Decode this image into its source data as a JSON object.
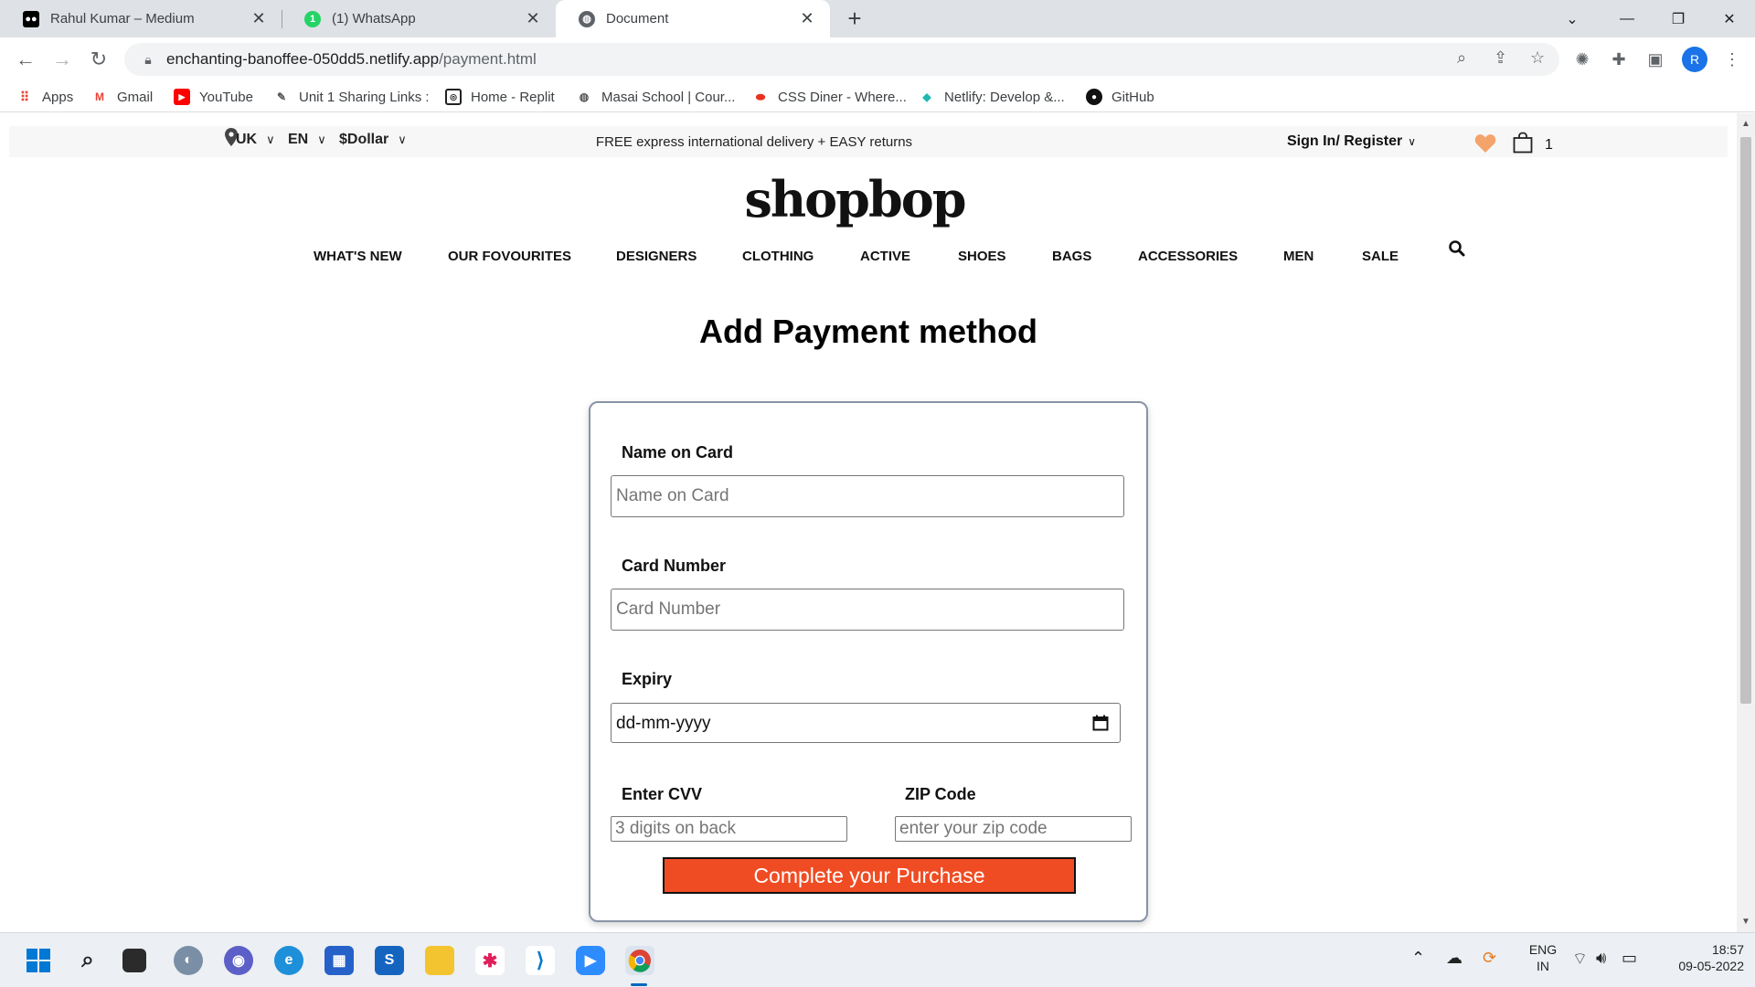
{
  "browser": {
    "tabs": [
      {
        "title": "Rahul Kumar – Medium",
        "icon": "medium-icon",
        "active": false
      },
      {
        "title": "(1) WhatsApp",
        "icon": "whatsapp-icon",
        "active": false
      },
      {
        "title": "Document",
        "icon": "globe-icon",
        "active": true
      }
    ],
    "url_domain": "enchanting-banoffee-050dd5.netlify.app",
    "url_path": "/payment.html",
    "profile_initial": "R",
    "bookmarks": [
      {
        "label": "Apps",
        "icon": "apps-grid-icon"
      },
      {
        "label": "Gmail",
        "icon": "gmail-icon"
      },
      {
        "label": "YouTube",
        "icon": "youtube-icon"
      },
      {
        "label": "Unit 1 Sharing Links :",
        "icon": "pen-icon"
      },
      {
        "label": "Home - Replit",
        "icon": "replit-icon"
      },
      {
        "label": "Masai School | Cour...",
        "icon": "masai-icon"
      },
      {
        "label": "CSS Diner - Where...",
        "icon": "css-diner-icon"
      },
      {
        "label": "Netlify: Develop &...",
        "icon": "netlify-icon"
      },
      {
        "label": "GitHub",
        "icon": "github-icon"
      }
    ]
  },
  "topbar": {
    "country": "UK",
    "language": "EN",
    "currency": "$Dollar",
    "delivery_text": "FREE express international delivery + EASY returns",
    "signin_label": "Sign In/ Register",
    "cart_count": "1"
  },
  "logo": "shopbop",
  "nav": [
    "WHAT'S NEW",
    "OUR FOVOURITES",
    "DESIGNERS",
    "CLOTHING",
    "ACTIVE",
    "SHOES",
    "BAGS",
    "ACCESSORIES",
    "MEN",
    "SALE"
  ],
  "page_title": "Add Payment method",
  "form": {
    "name_label": "Name on Card",
    "name_placeholder": "Name on Card",
    "card_label": "Card Number",
    "card_placeholder": "Card Number",
    "expiry_label": "Expiry",
    "expiry_value": "dd-mm-yyyy",
    "cvv_label": "Enter CVV",
    "cvv_placeholder": "3 digits on back",
    "zip_label": "ZIP Code",
    "zip_placeholder": "enter your zip code",
    "submit_label": "Complete your Purchase"
  },
  "colors": {
    "button": "#f04c23",
    "heart": "#f4a36b"
  },
  "taskbar": {
    "language": [
      "ENG",
      "IN"
    ],
    "time": "18:57",
    "date": "09-05-2022"
  }
}
